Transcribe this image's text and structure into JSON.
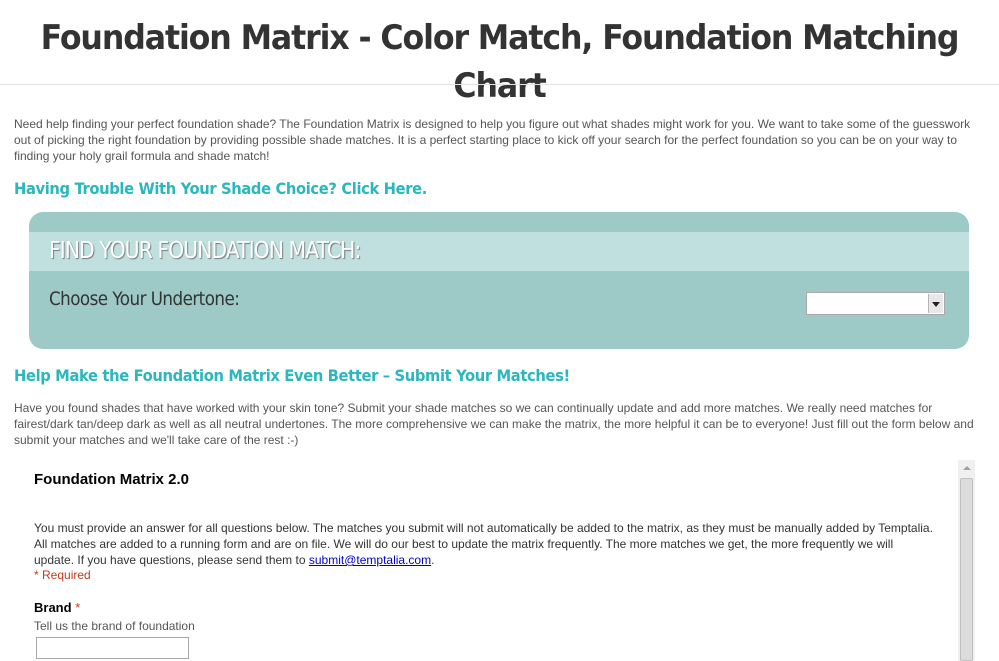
{
  "page": {
    "title": "Foundation Matrix - Color Match, Foundation Matching Chart",
    "intro": "Need help finding your perfect foundation shade? The Foundation Matrix is designed to help you figure out what shades might work for you. We want to take some of the guesswork out of picking the right foundation by providing possible shade matches. It is a perfect starting place to kick off your search for the perfect foundation so you can be on your way to finding your holy grail formula and shade match!"
  },
  "trouble_link": "Having Trouble With Your Shade Choice? Click Here.",
  "match_box": {
    "heading": "FIND YOUR FOUNDATION MATCH:",
    "undertone_label": "Choose Your Undertone:",
    "undertone_value": ""
  },
  "help_section": {
    "heading": "Help Make the Foundation Matrix Even Better – Submit Your Matches!",
    "text": "Have you found shades that have worked with your skin tone? Submit your shade matches so we can continually update and add more matches. We really need matches for fairest/dark tan/deep dark as well as all neutral undertones. The more comprehensive we can make the matrix, the more helpful it can be to everyone! Just fill out the form below and submit your matches and we'll take care of the rest :-)"
  },
  "form": {
    "title": "Foundation Matrix 2.0",
    "description": "You must provide an answer for all questions below.  The matches you submit will not automatically be added to the matrix, as they must be manually added by Temptalia.  All matches are added to a running form and are on file.  We will do our best to update the matrix frequently.  The more matches we get, the more frequently we will update.  If you have questions, please send them to ",
    "email": "submit@temptalia.com",
    "description_end": ".",
    "required_note": "* Required",
    "brand_label": "Brand",
    "brand_star": "*",
    "brand_help": "Tell us the brand of foundation",
    "brand_value": ""
  },
  "colors": {
    "accent_teal": "#2ab7bd",
    "match_box_bg": "#9dc9c6",
    "match_band_bg": "#bfe0df",
    "required_red": "#c43b1d"
  },
  "icons": {
    "select_arrow": "chevron-down-icon",
    "scroll_up": "scroll-up-arrow-icon"
  }
}
